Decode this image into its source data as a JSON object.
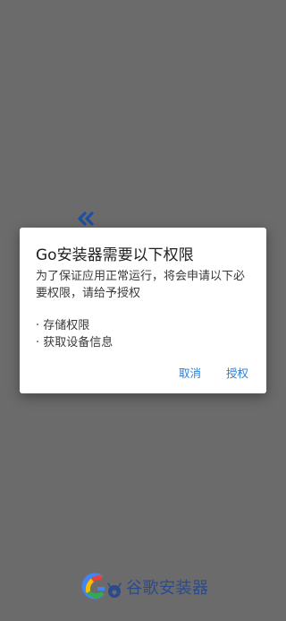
{
  "dialog": {
    "title": "Go安装器需要以下权限",
    "message": "为了保证应用正常运行，将会申请以下必要权限，请给予授权",
    "permissions": [
      "· 存储权限",
      "· 获取设备信息"
    ],
    "cancel_label": "取消",
    "grant_label": "授权"
  },
  "brand": {
    "name": "谷歌安装器"
  },
  "colors": {
    "overlay": "#6b6b6b",
    "accent": "#2a7fd6",
    "brand": "#2b4a8c"
  },
  "icons": {
    "back": "double-chevron-left-icon",
    "logo": "google-go-logo-icon"
  }
}
